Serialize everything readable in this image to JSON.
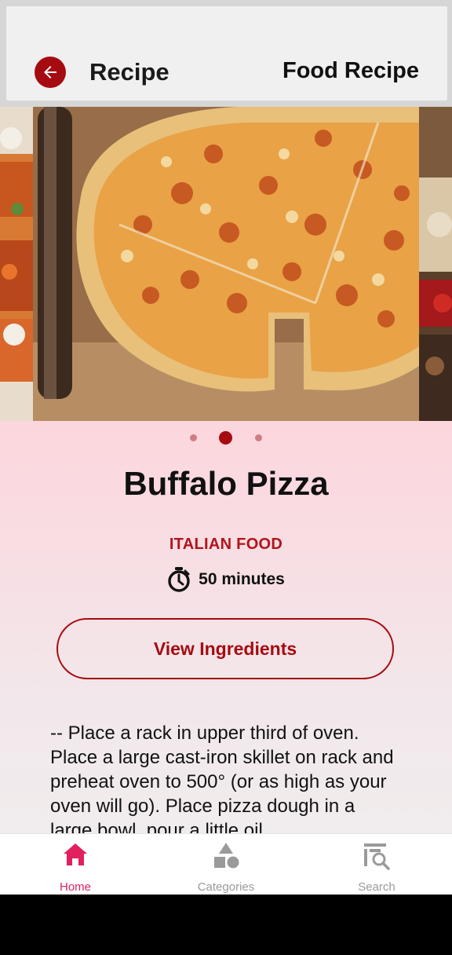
{
  "app_bar": {
    "title": "Recipe",
    "subtitle": "Food Recipe",
    "back_icon": "arrow-back-icon"
  },
  "carousel": {
    "active_index": 1,
    "count": 3
  },
  "recipe": {
    "name": "Buffalo Pizza",
    "category": "ITALIAN FOOD",
    "time": "50 minutes",
    "view_ingredients_label": "View Ingredients",
    "description": "-- Place a rack in upper third of oven. Place a large cast-iron skillet on rack and preheat oven to 500° (or as high as your oven will go). Place pizza dough in a large bowl, pour a little oil"
  },
  "bottom_nav": {
    "items": [
      {
        "label": "Home",
        "icon": "home-icon",
        "active": true
      },
      {
        "label": "Categories",
        "icon": "categories-icon",
        "active": false
      },
      {
        "label": "Search",
        "icon": "search-icon",
        "active": false
      }
    ]
  },
  "colors": {
    "accent": "#a50b10",
    "active_nav": "#e0215e",
    "background_top": "#ffd0d8"
  }
}
